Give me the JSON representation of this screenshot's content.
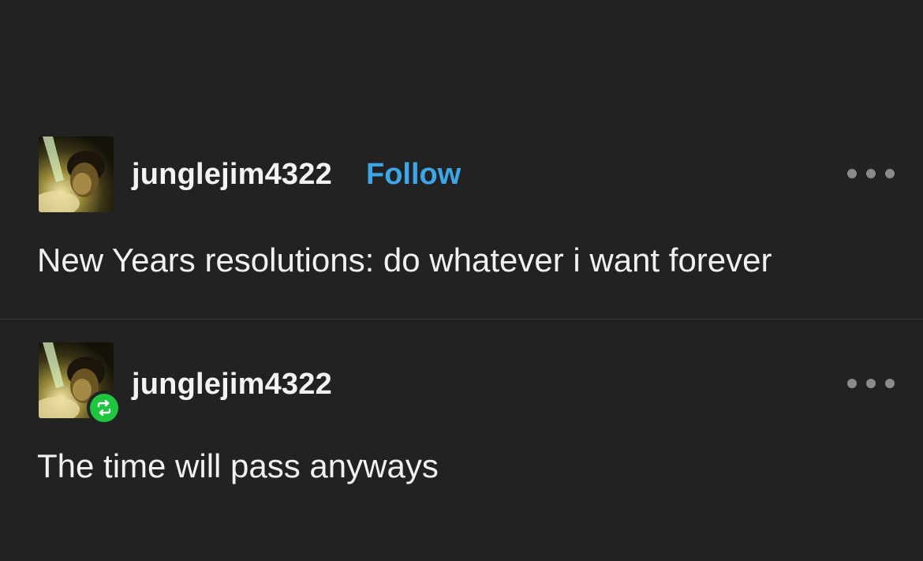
{
  "posts": [
    {
      "username": "junglejim4322",
      "follow_label": "Follow",
      "body": "New Years resolutions: do whatever i want forever",
      "avatar_icon": "user-avatar",
      "menu_icon": "more-options-icon"
    },
    {
      "username": "junglejim4322",
      "body": "The time will pass anyways",
      "avatar_icon": "user-avatar",
      "badge_icon": "reblog-icon",
      "menu_icon": "more-options-icon"
    }
  ],
  "colors": {
    "background": "#222223",
    "text": "#f1f1f1",
    "follow": "#3ea6e6",
    "reblog_badge": "#1fc43f",
    "divider": "#3a3a3c",
    "menu_dots": "#8b8b8d"
  }
}
